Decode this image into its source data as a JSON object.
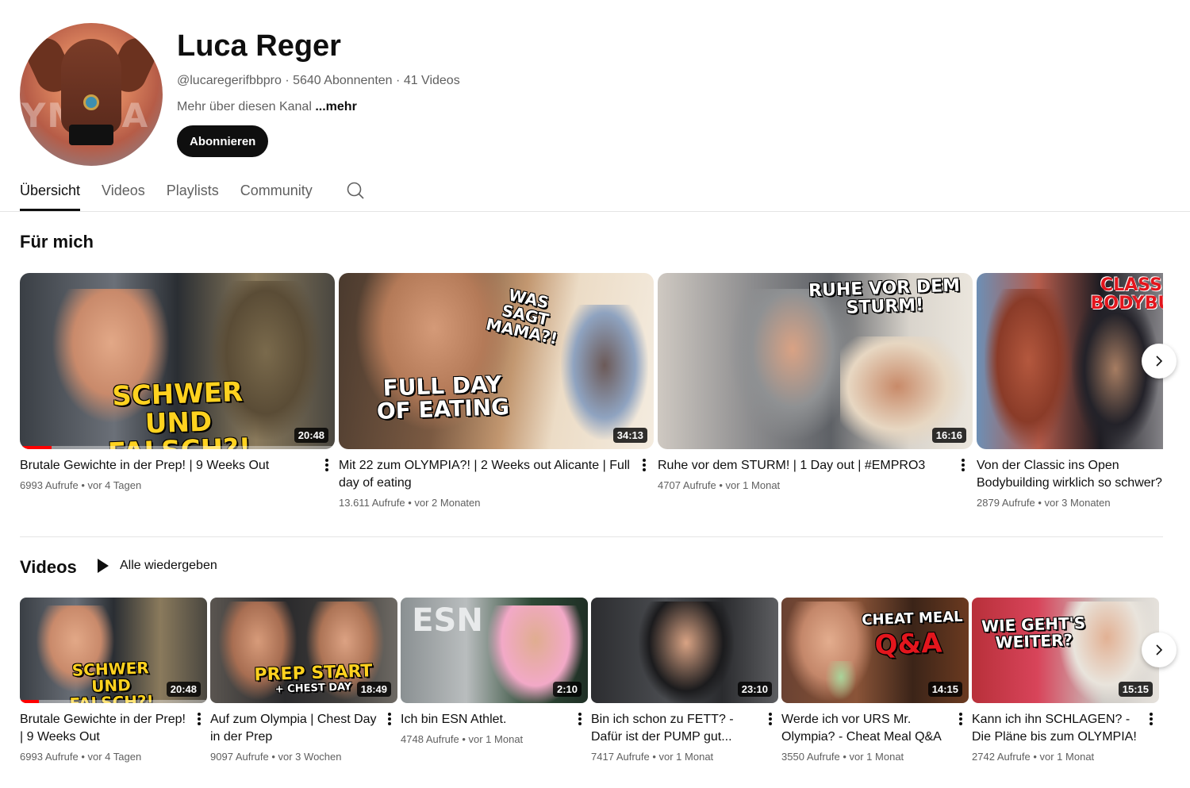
{
  "channel": {
    "name": "Luca Reger",
    "handle": "@lucaregerifbbpro",
    "subscribers": "5640 Abonnenten",
    "video_count": "41 Videos",
    "description": "Mehr über diesen Kanal",
    "more_label": "...mehr",
    "subscribe_label": "Abonnieren",
    "avatar_text": "YMPIA"
  },
  "tabs": [
    {
      "label": "Übersicht",
      "active": true
    },
    {
      "label": "Videos",
      "active": false
    },
    {
      "label": "Playlists",
      "active": false
    },
    {
      "label": "Community",
      "active": false
    }
  ],
  "sections": {
    "for_you": {
      "title": "Für mich"
    },
    "videos": {
      "title": "Videos",
      "play_all_label": "Alle wiedergeben"
    }
  },
  "for_you_videos": [
    {
      "title": "Brutale Gewichte in der Prep! | 9 Weeks Out",
      "views": "6993 Aufrufe",
      "age": "vor 4 Tagen",
      "duration": "20:48",
      "caption": "SCHWER UND FALSCH?!",
      "watched_fraction": 0.1
    },
    {
      "title": "Mit 22 zum OLYMPIA?! | 2 Weeks out Alicante | Full day of eating",
      "views": "13.611 Aufrufe",
      "age": "vor 2 Monaten",
      "duration": "34:13",
      "caption": "FULL DAY OF EATING",
      "caption2": "WAS SAGT MAMA?!"
    },
    {
      "title": "Ruhe vor dem STURM! | 1 Day out | #EMPRO3",
      "views": "4707 Aufrufe",
      "age": "vor 1 Monat",
      "duration": "16:16",
      "caption": "RUHE VOR DEM STURM!"
    },
    {
      "title": "Von der Classic ins Open Bodybuilding wirklich so schwer?",
      "views": "2879 Aufrufe",
      "age": "vor 3 Monaten",
      "duration": "",
      "caption": "CLASS BODYBU"
    }
  ],
  "channel_videos": [
    {
      "title": "Brutale Gewichte in der Prep! | 9 Weeks Out",
      "views": "6993 Aufrufe",
      "age": "vor 4 Tagen",
      "duration": "20:48",
      "caption": "SCHWER UND FALSCH?!",
      "watched_fraction": 0.1
    },
    {
      "title": "Auf zum Olympia | Chest Day in der Prep",
      "views": "9097 Aufrufe",
      "age": "vor 3 Wochen",
      "duration": "18:49",
      "caption": "PREP START",
      "caption2": "+ CHEST DAY"
    },
    {
      "title": "Ich bin ESN Athlet.",
      "views": "4748 Aufrufe",
      "age": "vor 1 Monat",
      "duration": "2:10",
      "caption": "ESN"
    },
    {
      "title": "Bin ich schon zu FETT? - Dafür ist der PUMP gut...",
      "views": "7417 Aufrufe",
      "age": "vor 1 Monat",
      "duration": "23:10",
      "caption": ""
    },
    {
      "title": "Werde ich vor URS Mr. Olympia? - Cheat Meal Q&A",
      "views": "3550 Aufrufe",
      "age": "vor 1 Monat",
      "duration": "14:15",
      "caption": "CHEAT MEAL",
      "caption2": "Q&A"
    },
    {
      "title": "Kann ich ihn SCHLAGEN? - Die Pläne bis zum OLYMPIA!",
      "views": "2742 Aufrufe",
      "age": "vor 1 Monat",
      "duration": "15:15",
      "caption": "WIE GEHT'S WEITER?"
    }
  ],
  "icons": {
    "search": "search-icon",
    "next": "chevron-right-icon",
    "menu": "kebab-menu-icon",
    "play": "play-icon"
  },
  "colors": {
    "text": "#0f0f0f",
    "secondary": "#606060",
    "progress": "#ff0000",
    "caption_yellow": "#ffd21f",
    "caption_red": "#e3161d"
  }
}
